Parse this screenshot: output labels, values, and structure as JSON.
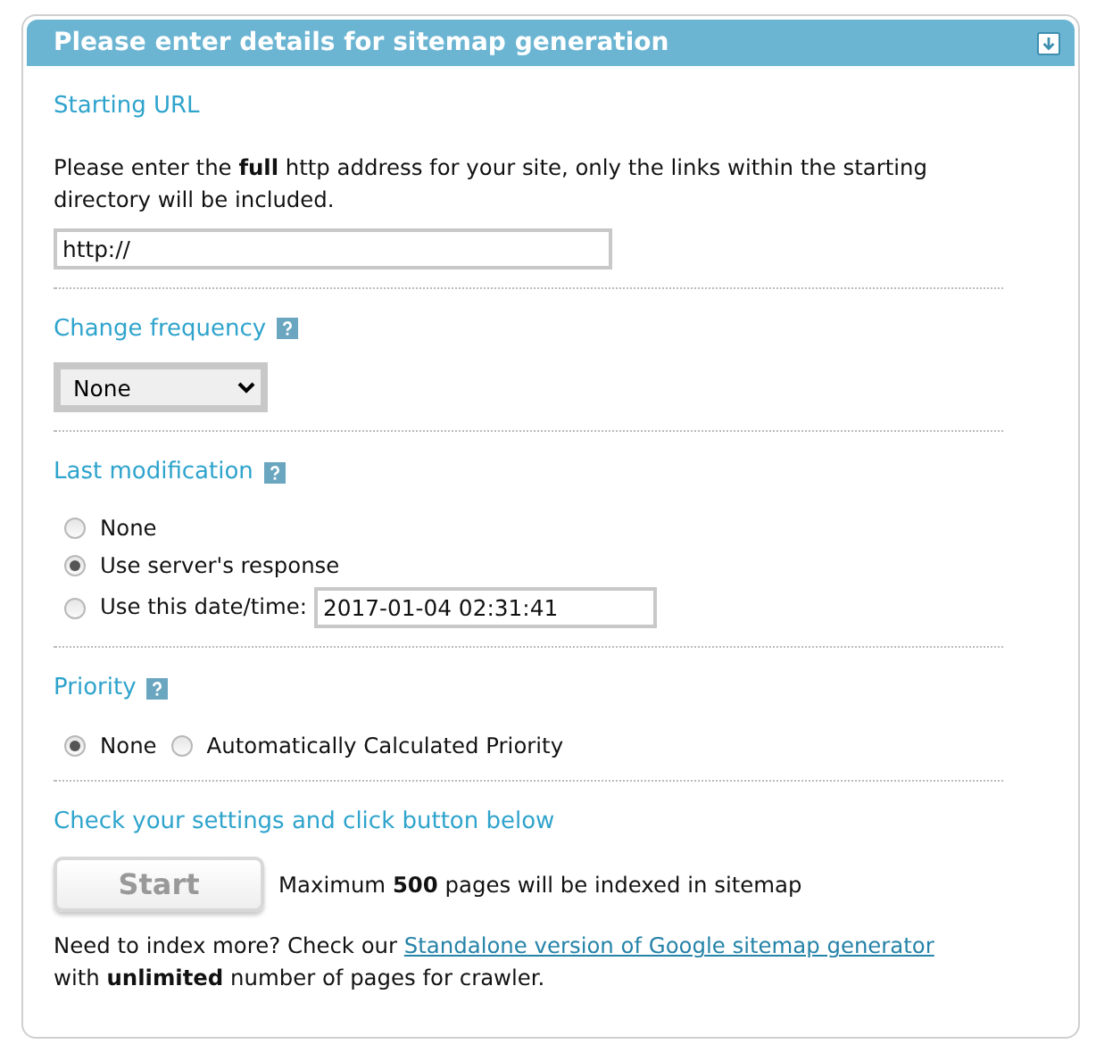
{
  "panel": {
    "title": "Please enter details for sitemap generation"
  },
  "sections": [
    {
      "kind": "url",
      "heading": "Starting URL",
      "help": false,
      "description": "Please enter the **full** http address for your site, only the links within the starting directory will be included.",
      "field": {
        "value": "http://"
      }
    },
    {
      "kind": "select",
      "heading": "Change frequency",
      "help": true,
      "select": {
        "value": "None"
      }
    },
    {
      "kind": "radio-list",
      "heading": "Last modification",
      "help": true,
      "options": [
        {
          "label": "None",
          "selected": false
        },
        {
          "label": "Use server's response",
          "selected": true
        },
        {
          "label": "Use this date/time:",
          "selected": false,
          "field": {
            "value": "2017-01-04 02:31:41"
          }
        }
      ]
    },
    {
      "kind": "radio-inline",
      "heading": "Priority",
      "help": true,
      "options": [
        {
          "label": "None",
          "selected": true
        },
        {
          "label": "Automatically Calculated Priority",
          "selected": false
        }
      ]
    },
    {
      "kind": "submit",
      "heading": "Check your settings and click button below",
      "help": false,
      "button": {
        "label": "Start",
        "disabled": true
      },
      "note": "Maximum **500** pages will be indexed in sitemap",
      "more": {
        "before": "Need to index more? Check our",
        "link": "Standalone version of Google sitemap generator",
        "after": "with **unlimited** number of pages for crawler."
      }
    }
  ]
}
